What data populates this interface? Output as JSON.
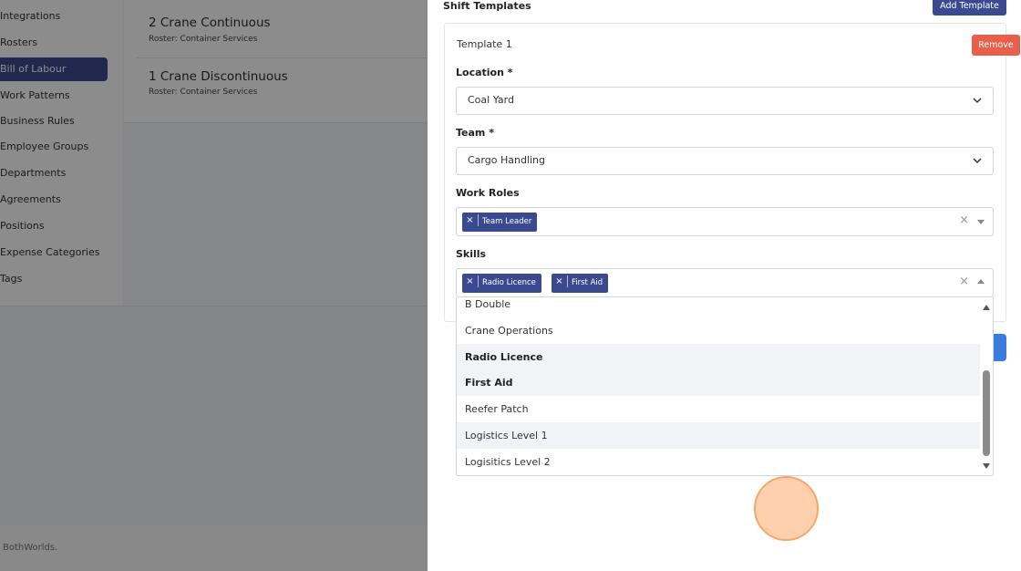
{
  "sidebar": {
    "items": [
      {
        "label": "Integrations"
      },
      {
        "label": "Rosters"
      },
      {
        "label": "Bill of Labour"
      },
      {
        "label": "Work Patterns"
      },
      {
        "label": "Business Rules"
      },
      {
        "label": "Employee Groups"
      },
      {
        "label": "Departments"
      },
      {
        "label": "Agreements"
      },
      {
        "label": "Positions"
      },
      {
        "label": "Expense Categories"
      },
      {
        "label": "Tags"
      }
    ]
  },
  "list": {
    "items": [
      {
        "title": "2 Crane Continuous",
        "subtitle": "Roster: Container Services"
      },
      {
        "title": "1 Crane Discontinuous",
        "subtitle": "Roster: Container Services"
      }
    ]
  },
  "footer": {
    "text": "BothWorlds."
  },
  "drawer": {
    "section_title": "Shift Templates",
    "add_template_label": "Add Template",
    "template": {
      "title": "Template 1",
      "remove_label": "Remove",
      "location": {
        "label": "Location *",
        "value": "Coal Yard"
      },
      "team": {
        "label": "Team *",
        "value": "Cargo Handling"
      },
      "work_roles": {
        "label": "Work Roles",
        "chips": [
          "Team Leader"
        ]
      },
      "skills": {
        "label": "Skills",
        "chips": [
          "Radio Licence",
          "First Aid"
        ],
        "options": [
          "B Double",
          "Crane Operations",
          "Radio Licence",
          "First Aid",
          "Reefer Patch",
          "Logistics Level 1",
          "Logisitics Level 2"
        ]
      }
    }
  },
  "colors": {
    "accent": "#3b4a8f",
    "danger": "#e8604c",
    "link": "#3a7bdc"
  }
}
